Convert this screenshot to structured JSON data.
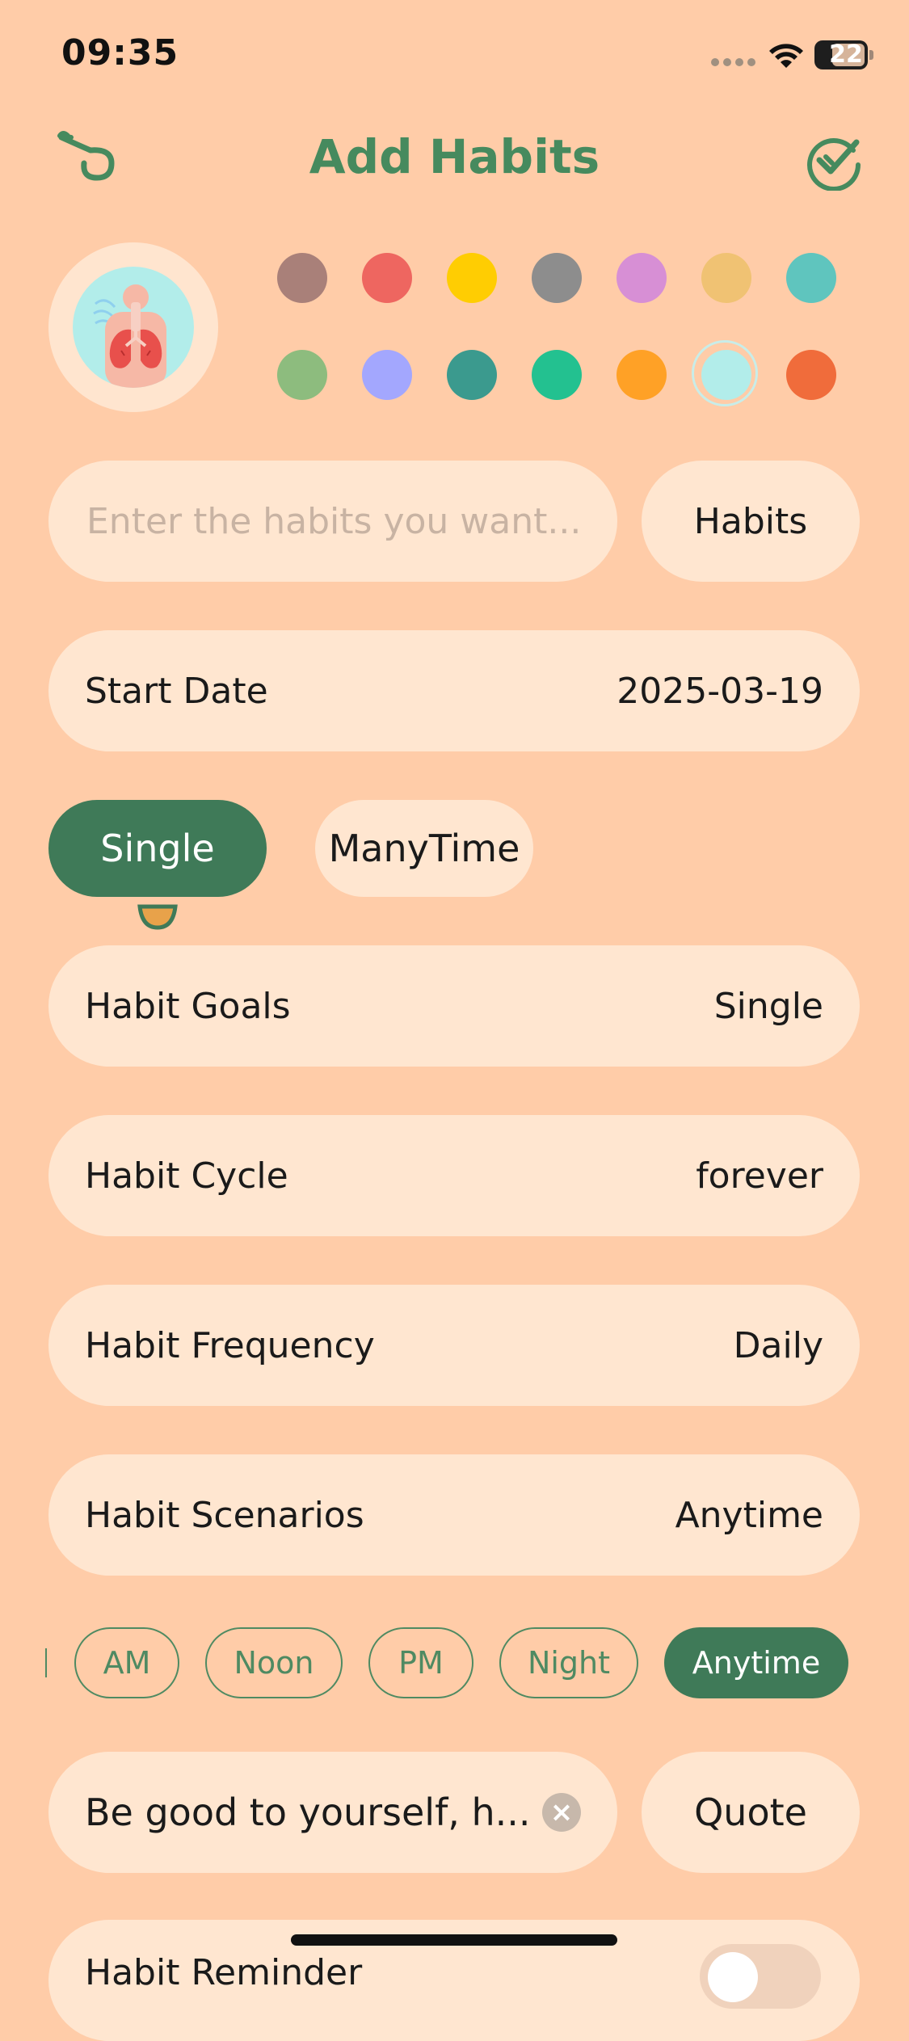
{
  "status_bar": {
    "time": "09:35",
    "battery": "22"
  },
  "header": {
    "title": "Add Habits"
  },
  "colors": {
    "accent": "#468a5e",
    "swatches": [
      "#A98079",
      "#EE6660",
      "#FFCD02",
      "#8D8D8D",
      "#D78FD5",
      "#F0C273",
      "#5FC5BE",
      "#8DBC7E",
      "#A3A7FE",
      "#3B9A8E",
      "#23C190",
      "#FFA126",
      "#B2EDEA",
      "#F06C3B"
    ],
    "selected_swatch": "#B2EDEA"
  },
  "icon": {
    "name": "lungs-icon"
  },
  "habit_input": {
    "placeholder": "Enter the habits you want...",
    "value": ""
  },
  "category_button": {
    "label": "Habits"
  },
  "start_date": {
    "label": "Start Date",
    "value": "2025-03-19"
  },
  "mode": {
    "options": [
      "Single",
      "ManyTime"
    ],
    "selected": "Single"
  },
  "settings": [
    {
      "label": "Habit Goals",
      "value": "Single"
    },
    {
      "label": "Habit Cycle",
      "value": "forever"
    },
    {
      "label": "Habit Frequency",
      "value": "Daily"
    },
    {
      "label": "Habit Scenarios",
      "value": "Anytime"
    }
  ],
  "time_chips": [
    {
      "label": "AM",
      "active": false
    },
    {
      "label": "Noon",
      "active": false
    },
    {
      "label": "PM",
      "active": false
    },
    {
      "label": "Night",
      "active": false
    },
    {
      "label": "Anytime",
      "active": true
    }
  ],
  "quote": {
    "value": "Be good to yourself, h...",
    "button_label": "Quote"
  },
  "reminder": {
    "label": "Habit Reminder"
  }
}
